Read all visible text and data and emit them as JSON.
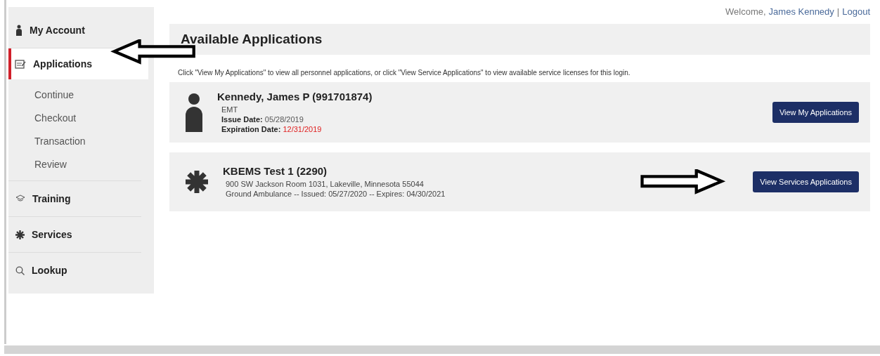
{
  "header": {
    "welcome": "Welcome,",
    "user_link": "James Kennedy",
    "separator": "|",
    "logout": "Logout"
  },
  "sidebar": {
    "items": [
      {
        "label": "My Account",
        "kind": "person",
        "selected": false
      },
      {
        "label": "Applications",
        "kind": "clipboard",
        "selected": true,
        "children": [
          {
            "label": "Continue"
          },
          {
            "label": "Checkout"
          },
          {
            "label": "Transaction"
          },
          {
            "label": "Review"
          }
        ]
      },
      {
        "label": "Training",
        "kind": "cap",
        "selected": false
      },
      {
        "label": "Services",
        "kind": "star",
        "selected": false
      },
      {
        "label": "Lookup",
        "kind": "search",
        "selected": false
      }
    ]
  },
  "page": {
    "title": "Available Applications",
    "intro": "Click \"View My Applications\" to view all personnel applications, or click \"View Service Applications\" to view available service licenses for this login.",
    "cards": [
      {
        "kind": "person",
        "title": "Kennedy, James P (991701874)",
        "lines": [
          {
            "text": "EMT"
          },
          {
            "label": "Issue Date:",
            "value": "05/28/2019",
            "alert": false
          },
          {
            "label": "Expiration Date:",
            "value": "12/31/2019",
            "alert": true
          }
        ],
        "button": "View My Applications",
        "pointer": false
      },
      {
        "kind": "service",
        "title": "KBEMS Test 1 (2290)",
        "lines": [
          {
            "text": "900 SW Jackson Room 1031, Lakeville, Minnesota 55044"
          },
          {
            "text": "Ground Ambulance -- Issued: 05/27/2020 -- Expires: 04/30/2021"
          }
        ],
        "button": "View Services Applications",
        "pointer": true
      }
    ]
  }
}
